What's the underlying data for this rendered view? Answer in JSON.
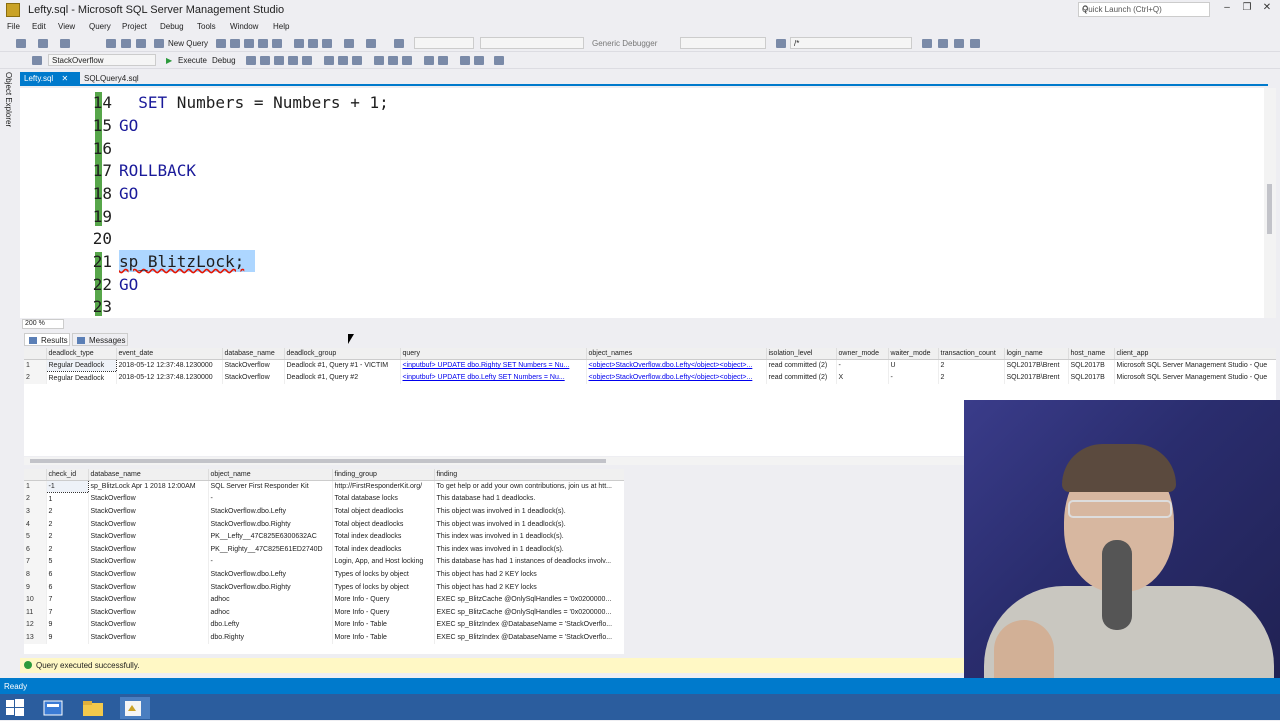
{
  "window": {
    "title": "Lefty.sql - Microsoft SQL Server Management Studio",
    "quick_launch_placeholder": "Quick Launch (Ctrl+Q)"
  },
  "menu": [
    "File",
    "Edit",
    "View",
    "Query",
    "Project",
    "Debug",
    "Tools",
    "Window",
    "Help"
  ],
  "toolbar": {
    "new_query": "New Query",
    "generic_debugger": "Generic Debugger",
    "comment_combo_value": "/*",
    "database": "StackOverflow",
    "execute": "Execute",
    "debug": "Debug"
  },
  "side_panel": {
    "label": "Object Explorer"
  },
  "tabs": [
    {
      "label": "Lefty.sql",
      "active": true
    },
    {
      "label": "SQLQuery4.sql",
      "active": false
    }
  ],
  "editor": {
    "zoom": "200 %",
    "lines": [
      {
        "num": "14",
        "text": "  SET Numbers = Numbers + 1;"
      },
      {
        "num": "15",
        "text": "GO"
      },
      {
        "num": "16",
        "text": ""
      },
      {
        "num": "17",
        "text": "ROLLBACK"
      },
      {
        "num": "18",
        "text": "GO"
      },
      {
        "num": "19",
        "text": ""
      },
      {
        "num": "20",
        "text": ""
      },
      {
        "num": "21",
        "text": "sp_BlitzLock;"
      },
      {
        "num": "22",
        "text": "GO"
      },
      {
        "num": "23",
        "text": ""
      }
    ]
  },
  "results_tabs": {
    "results": "Results",
    "messages": "Messages"
  },
  "grid1": {
    "columns": [
      "",
      "deadlock_type",
      "event_date",
      "database_name",
      "deadlock_group",
      "query",
      "object_names",
      "isolation_level",
      "owner_mode",
      "waiter_mode",
      "transaction_count",
      "login_name",
      "host_name",
      "client_app"
    ],
    "rows": [
      [
        "1",
        "Regular Deadlock",
        "2018-05-12 12:37:48.1230000",
        "StackOverflow",
        "Deadlock #1, Query #1 - VICTIM",
        "<inputbuf> UPDATE dbo.Righty  SET Numbers = Nu...",
        "<object>StackOverflow.dbo.Lefty</object><object>...",
        "read committed (2)",
        "-",
        "U",
        "2",
        "SQL2017B\\Brent",
        "SQL2017B",
        "Microsoft SQL Server Management Studio - Que"
      ],
      [
        "2",
        "Regular Deadlock",
        "2018-05-12 12:37:48.1230000",
        "StackOverflow",
        "Deadlock #1, Query #2",
        "<inputbuf> UPDATE dbo.Lefty  SET Numbers = Nu...",
        "<object>StackOverflow.dbo.Lefty</object><object>...",
        "read committed (2)",
        "X",
        "-",
        "2",
        "SQL2017B\\Brent",
        "SQL2017B",
        "Microsoft SQL Server Management Studio - Que"
      ]
    ]
  },
  "grid2": {
    "columns": [
      "",
      "check_id",
      "database_name",
      "object_name",
      "finding_group",
      "finding"
    ],
    "rows": [
      [
        "1",
        "-1",
        "sp_BlitzLock  Apr 1 2018 12:00AM",
        "SQL Server First Responder Kit",
        "http://FirstResponderKit.org/",
        "To get help or add your own contributions, join us at htt..."
      ],
      [
        "2",
        "1",
        "StackOverflow",
        "-",
        "Total database locks",
        "This database had 1 deadlocks."
      ],
      [
        "3",
        "2",
        "StackOverflow",
        "StackOverflow.dbo.Lefty",
        "Total object deadlocks",
        "This object was involved in 1 deadlock(s)."
      ],
      [
        "4",
        "2",
        "StackOverflow",
        "StackOverflow.dbo.Righty",
        "Total object deadlocks",
        "This object was involved in 1 deadlock(s)."
      ],
      [
        "5",
        "2",
        "StackOverflow",
        "PK__Lefty__47C825E6300632AC",
        "Total index deadlocks",
        "This index was involved in 1 deadlock(s)."
      ],
      [
        "6",
        "2",
        "StackOverflow",
        "PK__Righty__47C825E61ED2740D",
        "Total index deadlocks",
        "This index was involved in 1 deadlock(s)."
      ],
      [
        "7",
        "5",
        "StackOverflow",
        "-",
        "Login, App, and Host locking",
        "This database has had 1 instances of deadlocks involv..."
      ],
      [
        "8",
        "6",
        "StackOverflow",
        "StackOverflow.dbo.Lefty",
        "Types of locks by object",
        "This object has had  2 KEY locks"
      ],
      [
        "9",
        "6",
        "StackOverflow",
        "StackOverflow.dbo.Righty",
        "Types of locks by object",
        "This object has had  2 KEY locks"
      ],
      [
        "10",
        "7",
        "StackOverflow",
        "adhoc",
        "More Info - Query",
        "EXEC sp_BlitzCache  @OnlySqlHandles = '0x0200000..."
      ],
      [
        "11",
        "7",
        "StackOverflow",
        "adhoc",
        "More Info - Query",
        "EXEC sp_BlitzCache  @OnlySqlHandles = '0x0200000..."
      ],
      [
        "12",
        "9",
        "StackOverflow",
        "dbo.Lefty",
        "More Info - Table",
        "EXEC sp_BlitzIndex @DatabaseName = 'StackOverflo..."
      ],
      [
        "13",
        "9",
        "StackOverflow",
        "dbo.Righty",
        "More Info - Table",
        "EXEC sp_BlitzIndex @DatabaseName = 'StackOverflo..."
      ]
    ]
  },
  "query_status": "Query executed successfully.",
  "status_bar": "Ready",
  "colors": {
    "accent": "#007acc",
    "status_yellow": "#fff8c5",
    "keyword": "#1a1a9a"
  }
}
